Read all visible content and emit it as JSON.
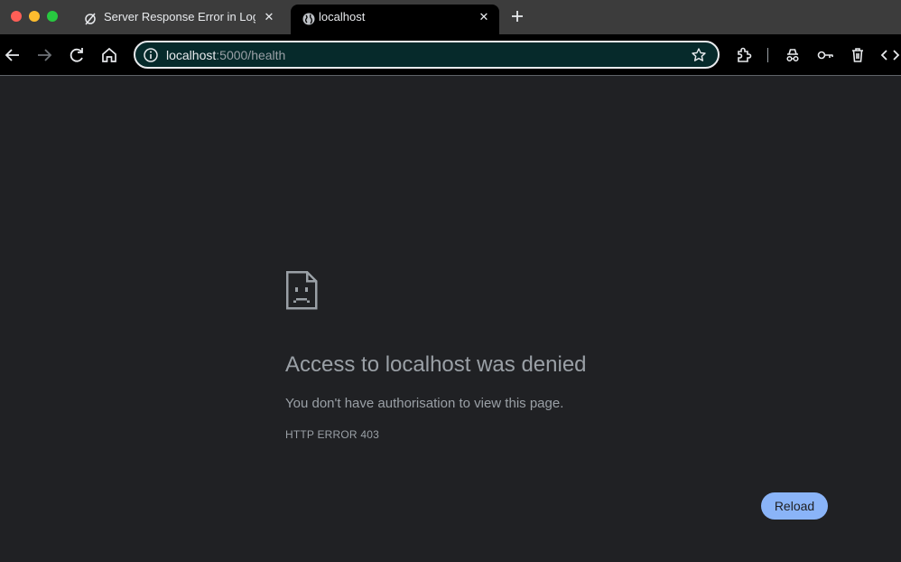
{
  "window": {
    "traffic_lights": [
      "close",
      "minimize",
      "zoom"
    ]
  },
  "tabs": [
    {
      "title": "Server Response Error in Logi",
      "favicon": "slash-circle-icon",
      "active": false
    },
    {
      "title": "localhost",
      "favicon": "globe-icon",
      "active": true
    }
  ],
  "toolbar": {
    "address": {
      "host": "localhost",
      "rest": ":5000/health"
    },
    "icons": [
      "back-icon",
      "forward-icon",
      "reload-icon",
      "home-icon",
      "site-info-icon",
      "bookmark-star-icon",
      "extensions-icon",
      "incognito-icon",
      "password-key-icon",
      "trash-icon",
      "code-icon"
    ]
  },
  "error_page": {
    "icon": "sad-document-icon",
    "title": "Access to localhost was denied",
    "description": "You don't have authorisation to view this page.",
    "code": "HTTP ERROR 403",
    "reload_label": "Reload"
  },
  "colors": {
    "accent": "#8ab4f8",
    "background": "#202124",
    "tab_strip": "#3c3c3c",
    "omnibox": "#062a2b"
  }
}
